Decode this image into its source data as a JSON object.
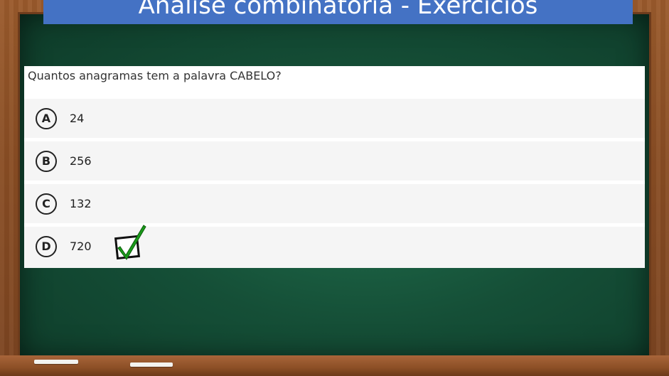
{
  "title": "Análise combinatória - Exercícios",
  "question": {
    "text": "Quantos anagramas tem a palavra CABELO?",
    "options": [
      {
        "letter": "A",
        "text": "24"
      },
      {
        "letter": "B",
        "text": "256"
      },
      {
        "letter": "C",
        "text": "132"
      },
      {
        "letter": "D",
        "text": "720"
      }
    ],
    "correct_option": "D"
  },
  "colors": {
    "title_bar": "#4472c4",
    "board": "#154f37",
    "frame": "#8a4e24",
    "check": "#1a9a1a"
  },
  "icons": [
    "checkbox-checkmark-icon"
  ]
}
